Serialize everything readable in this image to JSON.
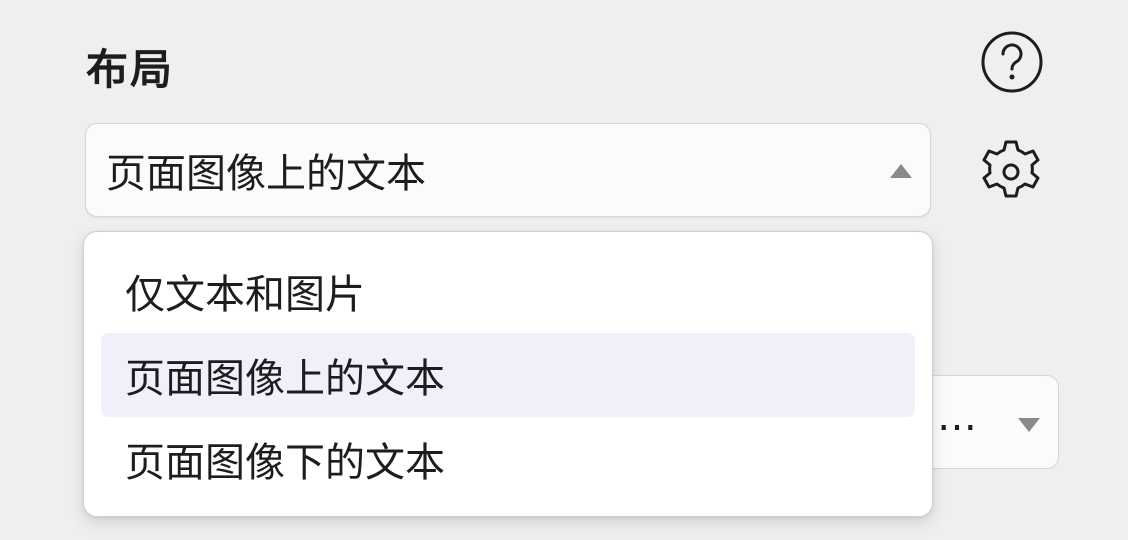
{
  "section": {
    "title": "布局"
  },
  "layout_select": {
    "value": "页面图像上的文本",
    "open": true,
    "options": [
      "仅文本和图片",
      "页面图像上的文本",
      "页面图像下的文本"
    ],
    "selected_index": 1
  },
  "second_select": {
    "value_visible": "…"
  },
  "icons": {
    "help": "help-icon",
    "settings": "gear-icon"
  },
  "colors": {
    "background": "#efefef",
    "selected_option_bg": "#f1eff9",
    "caret": "#8a8a8a"
  }
}
